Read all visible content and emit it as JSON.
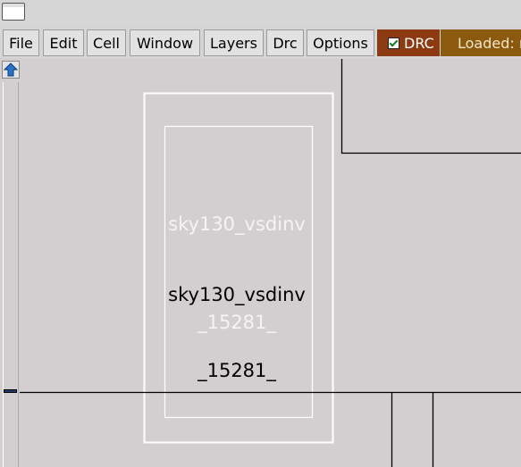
{
  "menu": {
    "items": [
      {
        "label": "File"
      },
      {
        "label": "Edit"
      },
      {
        "label": "Cell"
      },
      {
        "label": "Window"
      },
      {
        "label": "Layers"
      },
      {
        "label": "Drc"
      },
      {
        "label": "Options"
      }
    ],
    "drc_label": "DRC",
    "drc_checked": true,
    "loaded_label": "Loaded: n"
  },
  "layout": {
    "instance_name_outline": "sky130_vsdinv",
    "instance_name": "sky130_vsdinv",
    "instance_id_outline": "_15281_",
    "instance_id": "_15281_"
  },
  "colors": {
    "background": "#d3cfd1",
    "drc": "#8b3a12",
    "loaded": "#8c5a0e"
  },
  "icons": {
    "scroll_up": "up-arrow-icon"
  }
}
